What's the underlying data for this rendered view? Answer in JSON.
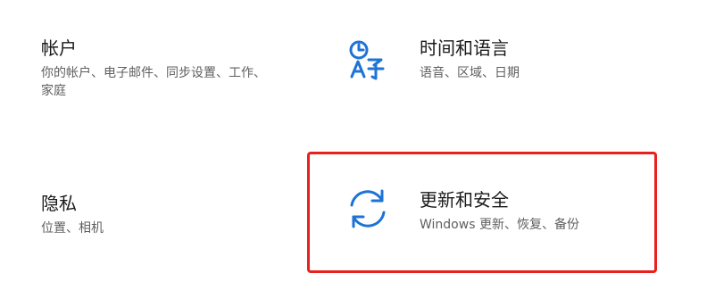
{
  "tiles": {
    "accounts": {
      "title": "帐户",
      "desc": "你的帐户、电子邮件、同步设置、工作、家庭"
    },
    "time_language": {
      "icon": "time-language-icon",
      "title": "时间和语言",
      "desc": "语音、区域、日期"
    },
    "privacy": {
      "title": "隐私",
      "desc": "位置、相机"
    },
    "update_security": {
      "icon": "sync-icon",
      "title": "更新和安全",
      "desc": "Windows 更新、恢复、备份"
    }
  },
  "colors": {
    "accent": "#1e73d6",
    "highlight": "#e8211d"
  }
}
